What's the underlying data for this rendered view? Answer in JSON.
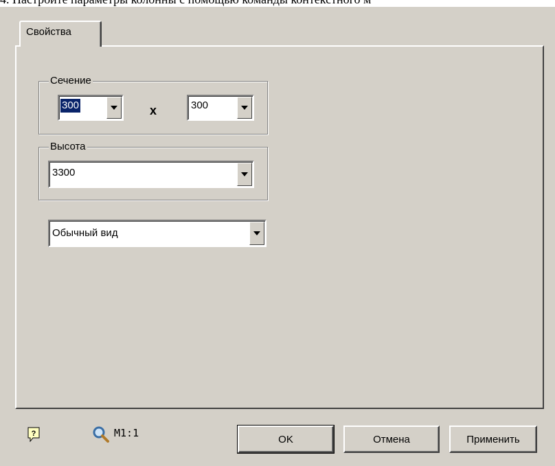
{
  "caption": "4. Настройте параметры колонны с помощью команды контекстного м",
  "tabs": [
    {
      "label": "Свойства"
    }
  ],
  "section": {
    "label": "Сечение",
    "width_value": "300",
    "separator": "x",
    "height_value": "300"
  },
  "height_group": {
    "label": "Высота",
    "value": "3300"
  },
  "view_select": {
    "value": "Обычный вид"
  },
  "status": {
    "scale": "M1:1"
  },
  "buttons": {
    "ok": "OK",
    "cancel": "Отмена",
    "apply": "Применить"
  },
  "colors": {
    "dialog_bg": "#d4d0c8",
    "selection": "#0a246a",
    "help_icon_bg": "#ffffc0",
    "zoom_icon": "#3a6ea5"
  }
}
